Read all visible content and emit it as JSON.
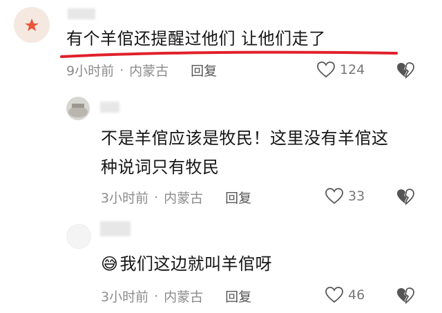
{
  "comments": [
    {
      "text": "有个羊倌还提醒过他们 让他们走了",
      "time": "9小时前",
      "separator": "·",
      "location": "内蒙古",
      "reply_label": "回复",
      "likes": "124",
      "like_icon": "heart-outline-icon",
      "dislike_icon": "broken-heart-icon"
    },
    {
      "text_line1": "不是羊倌应该是牧民！这里没有羊倌这",
      "text_line2": "种说词只有牧民",
      "time": "3小时前",
      "separator": "·",
      "location": "内蒙古",
      "reply_label": "回复",
      "likes": "33"
    },
    {
      "emoji": "😅",
      "text": "我们这边就叫羊倌呀",
      "time": "3小时前",
      "separator": "·",
      "location": "内蒙古",
      "reply_label": "回复",
      "likes": "46"
    }
  ],
  "colors": {
    "underline": "#e0202a",
    "meta": "#8b8b8b",
    "avatar1": "#f3e6de",
    "star": "#e8553a"
  }
}
